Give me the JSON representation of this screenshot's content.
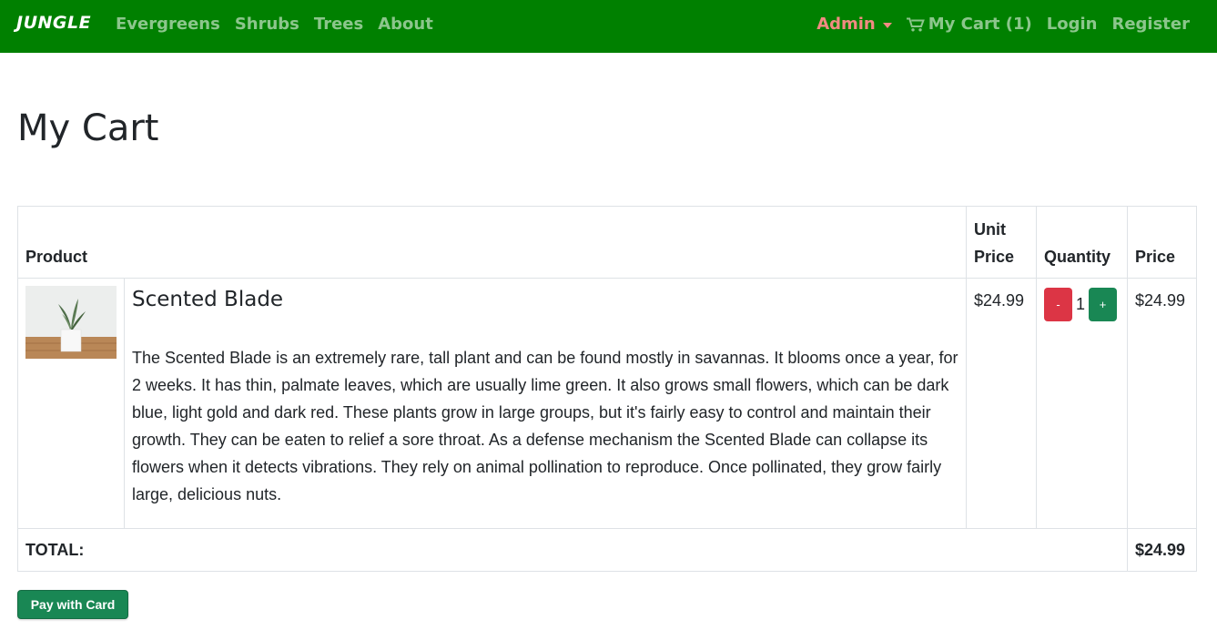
{
  "navbar": {
    "brand": "JUNGLE",
    "left_links": [
      "Evergreens",
      "Shrubs",
      "Trees",
      "About"
    ],
    "admin_label": "Admin",
    "cart_label": "My Cart (1)",
    "login_label": "Login",
    "register_label": "Register",
    "colors": {
      "bar": "#008000",
      "admin": "#f28b82"
    }
  },
  "page": {
    "title": "My Cart"
  },
  "table": {
    "headers": {
      "product": "Product",
      "unit_price": "Unit Price",
      "quantity": "Quantity",
      "price": "Price"
    },
    "rows": [
      {
        "name": "Scented Blade",
        "description": "The Scented Blade is an extremely rare, tall plant and can be found mostly in savannas. It blooms once a year, for 2 weeks. It has thin, palmate leaves, which are usually lime green. It also grows small flowers, which can be dark blue, light gold and dark red. These plants grow in large groups, but it's fairly easy to control and maintain their growth. They can be eaten to relief a sore throat. As a defense mechanism the Scented Blade can collapse its flowers when it detects vibrations. They rely on animal pollination to reproduce. Once pollinated, they grow fairly large, delicious nuts.",
        "unit_price": "$24.99",
        "quantity": "1",
        "price": "$24.99",
        "minus_label": "-",
        "plus_label": "+"
      }
    ],
    "total_label": "TOTAL:",
    "total_value": "$24.99"
  },
  "pay_button": "Pay with Card"
}
